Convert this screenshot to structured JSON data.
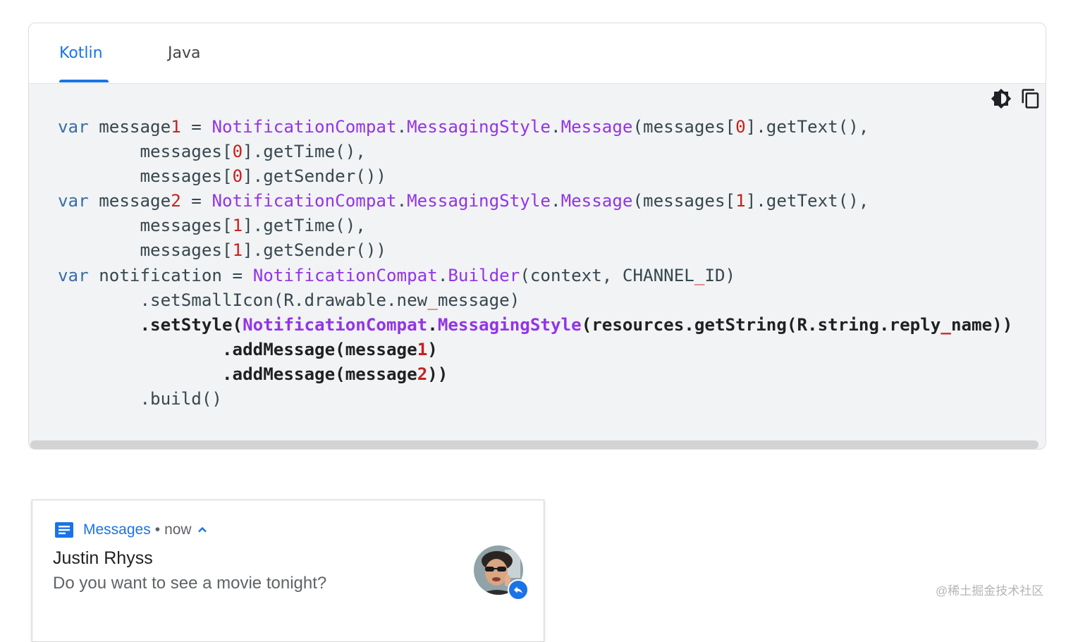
{
  "tabs": [
    {
      "label": "Kotlin",
      "active": true
    },
    {
      "label": "Java",
      "active": false
    }
  ],
  "toolbar": {
    "theme_icon": "brightness-icon",
    "copy_icon": "copy-icon"
  },
  "code": {
    "language": "Kotlin",
    "lines": [
      "var message1 = NotificationCompat.MessagingStyle.Message(messages[0].getText(),",
      "        messages[0].getTime(),",
      "        messages[0].getSender())",
      "var message2 = NotificationCompat.MessagingStyle.Message(messages[1].getText(),",
      "        messages[1].getTime(),",
      "        messages[1].getSender())",
      "var notification = NotificationCompat.Builder(context, CHANNEL_ID)",
      "        .setSmallIcon(R.drawable.new_message)",
      "        .setStyle(NotificationCompat.MessagingStyle(resources.getString(R.string.reply_name))",
      "                .addMessage(message1)",
      "                .addMessage(message2))",
      "        .build()"
    ],
    "highlighted_lines": [
      8,
      9,
      10
    ]
  },
  "notification": {
    "app_name": "Messages",
    "separator": "•",
    "time": "now",
    "sender": "Justin Rhyss",
    "message": "Do you want to see a movie tonight?",
    "app_icon": "messages-icon",
    "reply_icon": "reply-icon"
  },
  "watermark": "@稀土掘金技术社区",
  "colors": {
    "accent": "#1a73e8",
    "keyword": "#3a6ea5",
    "type": "#9334e6",
    "number": "#c5221f",
    "code_bg": "#f1f3f4"
  }
}
